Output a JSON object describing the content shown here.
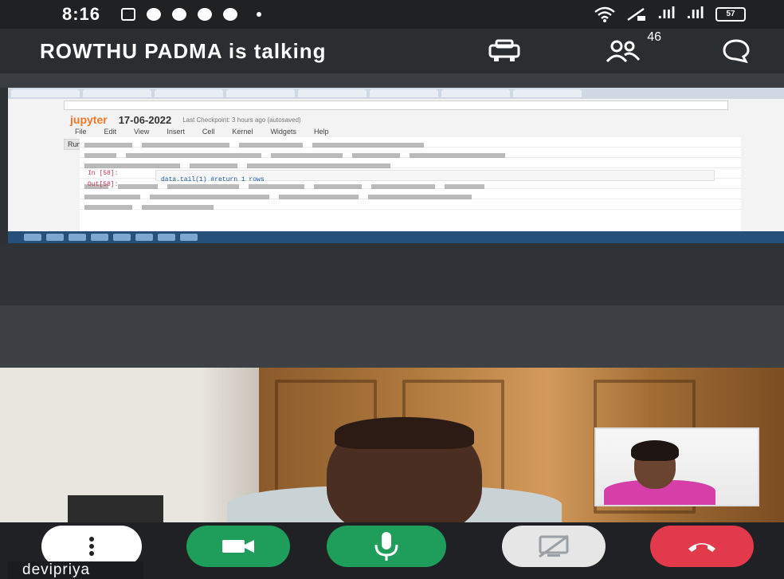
{
  "status_bar": {
    "time": "8:16",
    "battery": "57",
    "signal1": ".ııl",
    "signal2": ".ııl"
  },
  "header": {
    "talking_text": "ROWTHU PADMA is talking",
    "participant_count": "46"
  },
  "shared_screen": {
    "app_name": "jupyter",
    "notebook_date": "17-06-2022",
    "notebook_status": "Last Checkpoint: 3 hours ago (autosaved)",
    "menu": [
      "File",
      "Edit",
      "View",
      "Insert",
      "Cell",
      "Kernel",
      "Widgets",
      "Help"
    ],
    "cell_label_in": "In [58]:",
    "cell_label_out": "Out[58]:",
    "code_text": "data.tail(1)  #return 1 rows",
    "run_label": "Run",
    "cell_type": "Code"
  },
  "self_view": {
    "name": "devipriya"
  },
  "colors": {
    "video_button": "#1e9e5a",
    "mic_button": "#1e9e5a",
    "end_call": "#e23a4a",
    "present_disabled": "#e6e6e6",
    "more_button": "#ffffff"
  }
}
